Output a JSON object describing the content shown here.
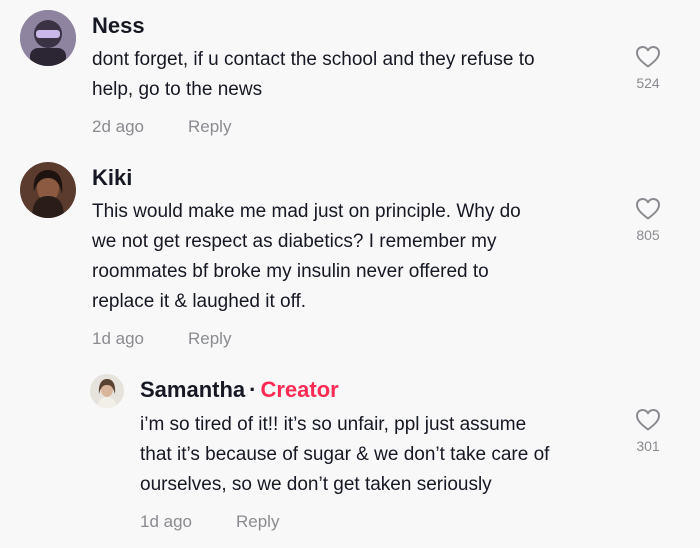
{
  "comments": [
    {
      "username": "Ness",
      "lines": [
        "dont forget, if u contact the school and they refuse to",
        "help, go to the news"
      ],
      "time": "2d ago",
      "reply": "Reply",
      "likes": "524"
    },
    {
      "username": "Kiki",
      "lines": [
        "This would make me mad just on principle. Why do",
        "we not get respect as diabetics? I remember my",
        "roommates bf broke my insulin never offered to",
        "replace it & laughed it off."
      ],
      "time": "1d ago",
      "reply": "Reply",
      "likes": "805"
    },
    {
      "username": "Samantha",
      "separator": "·",
      "badge": "Creator",
      "lines": [
        "i’m so tired of it!! it’s so unfair, ppl just assume",
        "that it’s because of sugar & we don’t take care of",
        "ourselves, so we don’t get taken seriously"
      ],
      "time": "1d ago",
      "reply": "Reply",
      "likes": "301"
    }
  ],
  "colors": {
    "background": "#f8f8f8",
    "text": "#161823",
    "muted": "#8a8b91",
    "creator": "#fe2c55"
  },
  "icons": {
    "like": "heart-outline-icon"
  }
}
